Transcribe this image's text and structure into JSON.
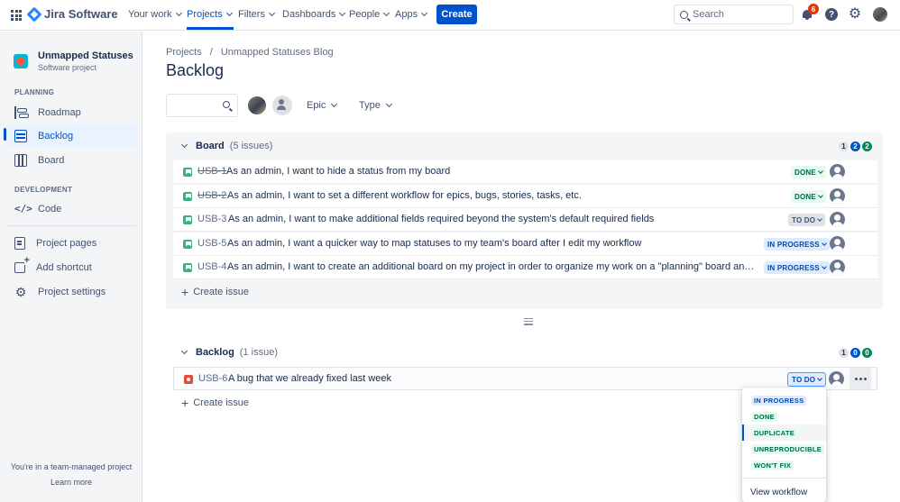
{
  "topnav": {
    "product": "Jira Software",
    "items": [
      "Your work",
      "Projects",
      "Filters",
      "Dashboards",
      "People",
      "Apps"
    ],
    "create_label": "Create",
    "search_placeholder": "Search",
    "notification_count": "6"
  },
  "sidebar": {
    "project_name": "Unmapped Statuses Blog",
    "project_type": "Software project",
    "planning_heading": "PLANNING",
    "planning_items": [
      "Roadmap",
      "Backlog",
      "Board"
    ],
    "development_heading": "DEVELOPMENT",
    "development_items": [
      "Code"
    ],
    "other_items": [
      "Project pages",
      "Add shortcut",
      "Project settings"
    ],
    "footer_text": "You're in a team-managed project",
    "footer_link": "Learn more"
  },
  "breadcrumb": [
    "Projects",
    "/",
    "Unmapped Statuses Blog"
  ],
  "page_title": "Backlog",
  "filters": {
    "epic": "Epic",
    "type": "Type"
  },
  "board_sprint": {
    "title": "Board",
    "count": "(5 issues)",
    "counts": [
      "1",
      "2",
      "2"
    ],
    "issues": [
      {
        "key": "USB-1",
        "summary": "As an admin, I want to hide a status from my board",
        "status": "DONE"
      },
      {
        "key": "USB-2",
        "summary": "As an admin, I want to set a different workflow for epics, bugs, stories, tasks, etc.",
        "status": "DONE"
      },
      {
        "key": "USB-3",
        "summary": "As an admin, I want to make additional fields required beyond the system's default required fields",
        "status": "TO DO"
      },
      {
        "key": "USB-5",
        "summary": "As an admin, I want a quicker way to map statuses to my team's board after I edit my workflow",
        "status": "IN PROGRESS"
      },
      {
        "key": "USB-4",
        "summary": "As an admin, I want to create an additional board on my project in order to organize my work on a \"planning\" board and a \"development\" board",
        "status": "IN PROGRESS"
      }
    ],
    "create_issue": "Create issue"
  },
  "backlog": {
    "title": "Backlog",
    "count": "(1 issue)",
    "counts": [
      "1",
      "0",
      "0"
    ],
    "issues": [
      {
        "key": "USB-6",
        "summary": "A bug that we already fixed last week",
        "status": "TO DO"
      }
    ],
    "create_issue": "Create issue"
  },
  "status_menu": {
    "options": [
      "IN PROGRESS",
      "DONE",
      "DUPLICATE",
      "UNREPRODUCIBLE",
      "WON'T FIX"
    ],
    "view_workflow": "View workflow"
  }
}
